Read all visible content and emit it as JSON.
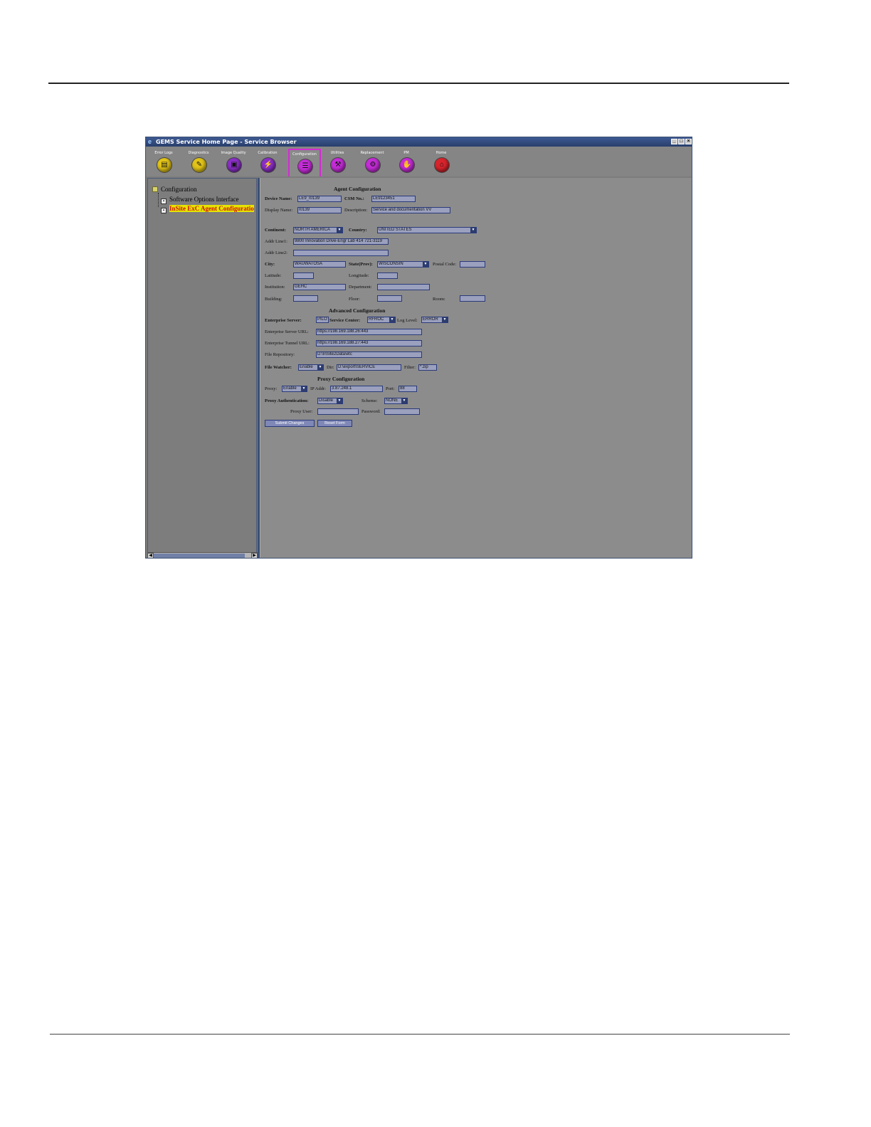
{
  "window": {
    "title": "GEMS Service Home Page - Service Browser"
  },
  "toolbar": {
    "items": [
      {
        "label": "Error Logs",
        "icon": "error-logs-icon",
        "color": "#e2c418"
      },
      {
        "label": "Diagnostics",
        "icon": "diagnostics-icon",
        "color": "#e2c418"
      },
      {
        "label": "Image Quality",
        "icon": "image-quality-icon",
        "color": "#8a2fc6"
      },
      {
        "label": "Calibration",
        "icon": "calibration-icon",
        "color": "#8a2fc6"
      },
      {
        "label": "Configuration",
        "icon": "configuration-icon",
        "color": "#c52cd8"
      },
      {
        "label": "Utilities",
        "icon": "utilities-icon",
        "color": "#c52cd8"
      },
      {
        "label": "Replacement",
        "icon": "replacement-icon",
        "color": "#c52cd8"
      },
      {
        "label": "PM",
        "icon": "pm-icon",
        "color": "#c52cd8"
      },
      {
        "label": "Home",
        "icon": "home-icon",
        "color": "#d8242c"
      }
    ],
    "active": "Configuration",
    "accent": "#d22bd2"
  },
  "tree": {
    "root": "Configuration",
    "children": [
      "Software Options Interface",
      "InSite ExC Agent Configuratio"
    ]
  },
  "form": {
    "agent_header": "Agent Configuration",
    "device_name_label": "Device Name:",
    "device_name": "LE9_I0139",
    "csm_label": "CSM No.:",
    "csm": "LE9123451",
    "display_name_label": "Display Name:",
    "display_name": "I0139",
    "description_label": "Description:",
    "description": "Service and documentation VV",
    "continent_label": "Continent:",
    "continent": "NORTH AMERICA",
    "country_label": "Country:",
    "country": "UNITED STATES",
    "addr1_label": "Addr Line1:",
    "addr1": "9800 Innovation Drive-Engr Lab 414 721-3119",
    "addr2_label": "Addr Line2:",
    "addr2": "",
    "city_label": "City:",
    "city": "WAUWATOSA",
    "state_label": "State(Prov):",
    "state": "WISCONSIN",
    "postal_label": "Postal Code:",
    "postal": "",
    "latitude_label": "Latitude:",
    "latitude": "",
    "longitude_label": "Longitude:",
    "longitude": "",
    "institution_label": "Institution:",
    "institution": "GEHC",
    "department_label": "Department:",
    "department": "",
    "building_label": "Building:",
    "building": "",
    "floor_label": "Floor:",
    "floor": "",
    "room_label": "Room:",
    "room": "",
    "advanced_header": "Advanced Configuration",
    "enterprise_server_label": "Enterprise Server:",
    "enterprise_server": "PILO",
    "service_center_label": "Service Center:",
    "service_center": "RFROC",
    "log_level_label": "Log Level:",
    "log_level": "ERROR",
    "enterprise_url_label": "Enterprise Server URL:",
    "enterprise_url": "https://198.169.188.26:443",
    "tunnel_url_label": "Enterprise Tunnel URL:",
    "tunnel_url": "https://198.169.188.27:443",
    "file_repo_label": "File Repository:",
    "file_repo": "D:\\InSite2Data\\etc",
    "file_watcher_label": "File Watcher:",
    "file_watcher": "Enable",
    "dir_label": "Dir:",
    "dir": "D:\\export\\SERVICE",
    "filter_label": "Filter:",
    "filter": "*.zip",
    "proxy_header": "Proxy Configuration",
    "proxy_label": "Proxy:",
    "proxy": "Enable",
    "ip_label": "IP Addr:",
    "ip": "3.87.248.1",
    "port_label": "Port:",
    "port": "88",
    "proxy_auth_label": "Proxy Authentication:",
    "proxy_auth": "Disable",
    "scheme_label": "Scheme:",
    "scheme": "NONE",
    "proxy_user_label": "Proxy User:",
    "proxy_user": "",
    "password_label": "Password:",
    "password": "",
    "submit_label": "Submit Changes",
    "reset_label": "Reset Form"
  }
}
